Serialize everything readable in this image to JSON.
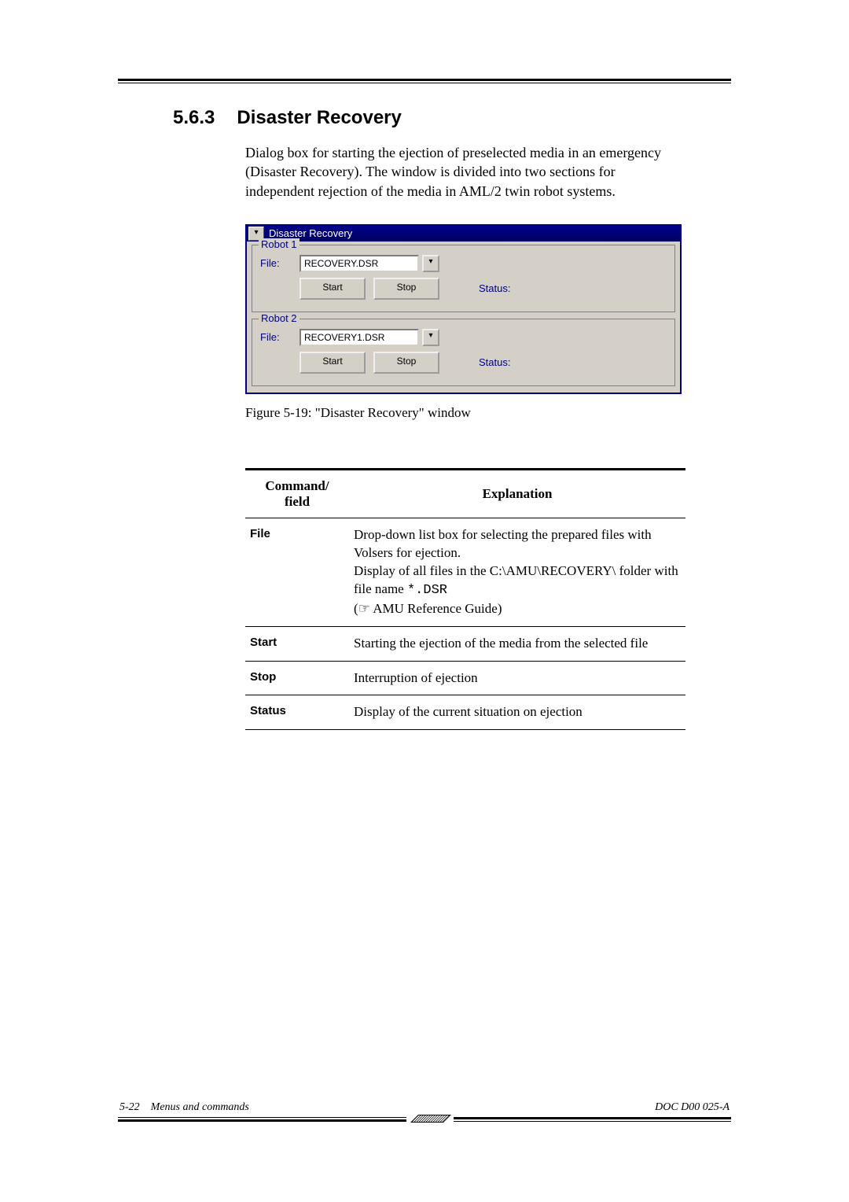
{
  "section": {
    "number": "5.6.3",
    "title": "Disaster Recovery"
  },
  "body": "Dialog box for starting the ejection of preselected media in an emergency (Disaster Recovery). The window is divided into two sections for independent rejection of the media in AML/2 twin robot systems.",
  "window": {
    "title": "Disaster Recovery",
    "robots": [
      {
        "legend": "Robot 1",
        "file_label": "File:",
        "file_value": "RECOVERY.DSR",
        "start": "Start",
        "stop": "Stop",
        "status_label": "Status:"
      },
      {
        "legend": "Robot 2",
        "file_label": "File:",
        "file_value": "RECOVERY1.DSR",
        "start": "Start",
        "stop": "Stop",
        "status_label": "Status:"
      }
    ]
  },
  "figure_caption": "Figure 5-19: \"Disaster Recovery\" window",
  "table": {
    "head": {
      "col1": "Command/\nfield",
      "col2": "Explanation"
    },
    "rows": [
      {
        "cmd": "File",
        "exp_pre": "Drop-down list box for selecting the prepared files with Volsers for ejection.\nDisplay of all files in the C:\\AMU\\RECOVERY\\ folder with file name ",
        "exp_code": "*.DSR",
        "exp_post": "\n(☞ AMU Reference Guide)"
      },
      {
        "cmd": "Start",
        "exp_pre": "Starting the ejection of the media from the selected file",
        "exp_code": "",
        "exp_post": ""
      },
      {
        "cmd": "Stop",
        "exp_pre": "Interruption of ejection",
        "exp_code": "",
        "exp_post": ""
      },
      {
        "cmd": "Status",
        "exp_pre": "Display of the current situation on ejection",
        "exp_code": "",
        "exp_post": ""
      }
    ]
  },
  "footer": {
    "page": "5-22",
    "chapter": "Menus and commands",
    "doc": "DOC D00 025-A"
  }
}
